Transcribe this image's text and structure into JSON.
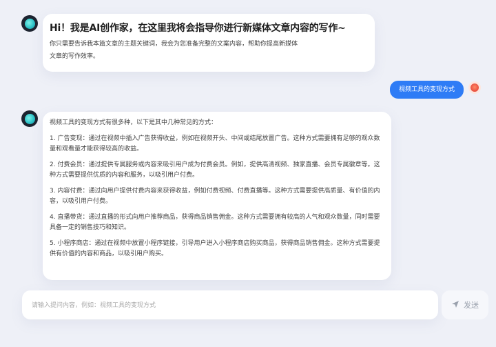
{
  "greeting": {
    "title": "Hi！我是AI创作家，在这里我将会指导你进行新媒体文章内容的写作~",
    "line1": "你只需要告诉我本篇文章的主题关键词，我会为您准备完整的文案内容，帮助你提高新媒体",
    "line2": "文章的写作效率。"
  },
  "user_message": "视频工具的变现方式",
  "answer": {
    "intro": "视频工具的变现方式有很多种，以下是其中几种常见的方式：",
    "points": [
      "1. 广告变现：通过在视频中插入广告获得收益，例如在视频开头、中间或结尾放置广告。这种方式需要拥有足够的观众数量和观看量才能获得较高的收益。",
      "2. 付费会员：通过提供专属服务或内容来吸引用户成为付费会员。例如，提供高清视频、独家直播、会员专属徽章等。这种方式需要提供优质的内容和服务，以吸引用户付费。",
      "3. 内容付费：通过向用户提供付费内容来获得收益，例如付费视频、付费直播等。这种方式需要提供高质量、有价值的内容，以吸引用户付费。",
      "4. 直播带货：通过直播的形式向用户推荐商品，获得商品销售佣金。这种方式需要拥有较高的人气和观众数量，同时需要具备一定的销售技巧和知识。",
      "5. 小程序商店：通过在视频中放置小程序链接，引导用户进入小程序商店购买商品，获得商品销售佣金。这种方式需要提供有价值的内容和商品，以吸引用户购买。"
    ]
  },
  "input": {
    "placeholder": "请输入提问内容，例如：视频工具的变现方式",
    "value": ""
  },
  "send_label": "发送",
  "colors": {
    "background": "#eef0f7",
    "user_bubble": "#2e7cf6",
    "send_disabled": "#9aa1ad"
  },
  "icons": {
    "bot_avatar": "bot-avatar",
    "user_avatar": "user-avatar",
    "send": "paper-plane-icon"
  }
}
